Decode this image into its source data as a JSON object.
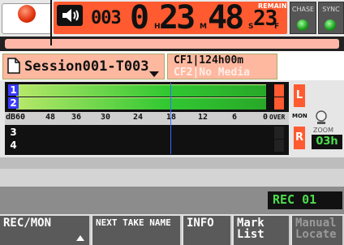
{
  "counter": {
    "take_number": "003",
    "hours": "0",
    "minutes": "23",
    "seconds": "48",
    "frames": "23",
    "unit_h": "H",
    "unit_m": "M",
    "unit_s": "S",
    "unit_f": "F",
    "remain_label": "REMAIN",
    "progress_fraction": 0.12
  },
  "indicators": {
    "chase_label": "CHASE",
    "sync_label": "SYNC"
  },
  "session": {
    "name": "Session001-T003",
    "cf1": "CF1|124h00m",
    "cf2": "CF2|No Media"
  },
  "meters": {
    "channels": [
      "1",
      "2",
      "3",
      "4"
    ],
    "scale": [
      "dB60",
      "48",
      "36",
      "30",
      "24",
      "18",
      "12",
      "6",
      "0",
      "OVER"
    ],
    "monitor_label": "MON",
    "monitor_l": "L",
    "monitor_r": "R",
    "zoom_label": "ZOOM",
    "zoom_value": "03h"
  },
  "status": {
    "text": "REC 01"
  },
  "function_keys": {
    "f1": "REC/MON",
    "f2": "NEXT TAKE NAME",
    "f3": "INFO",
    "f4": "Mark List",
    "f5": "Manual Locate"
  },
  "colors": {
    "accent": "#ff5a30",
    "meter_green": "#32c832",
    "status_green": "#4ddc4d"
  }
}
